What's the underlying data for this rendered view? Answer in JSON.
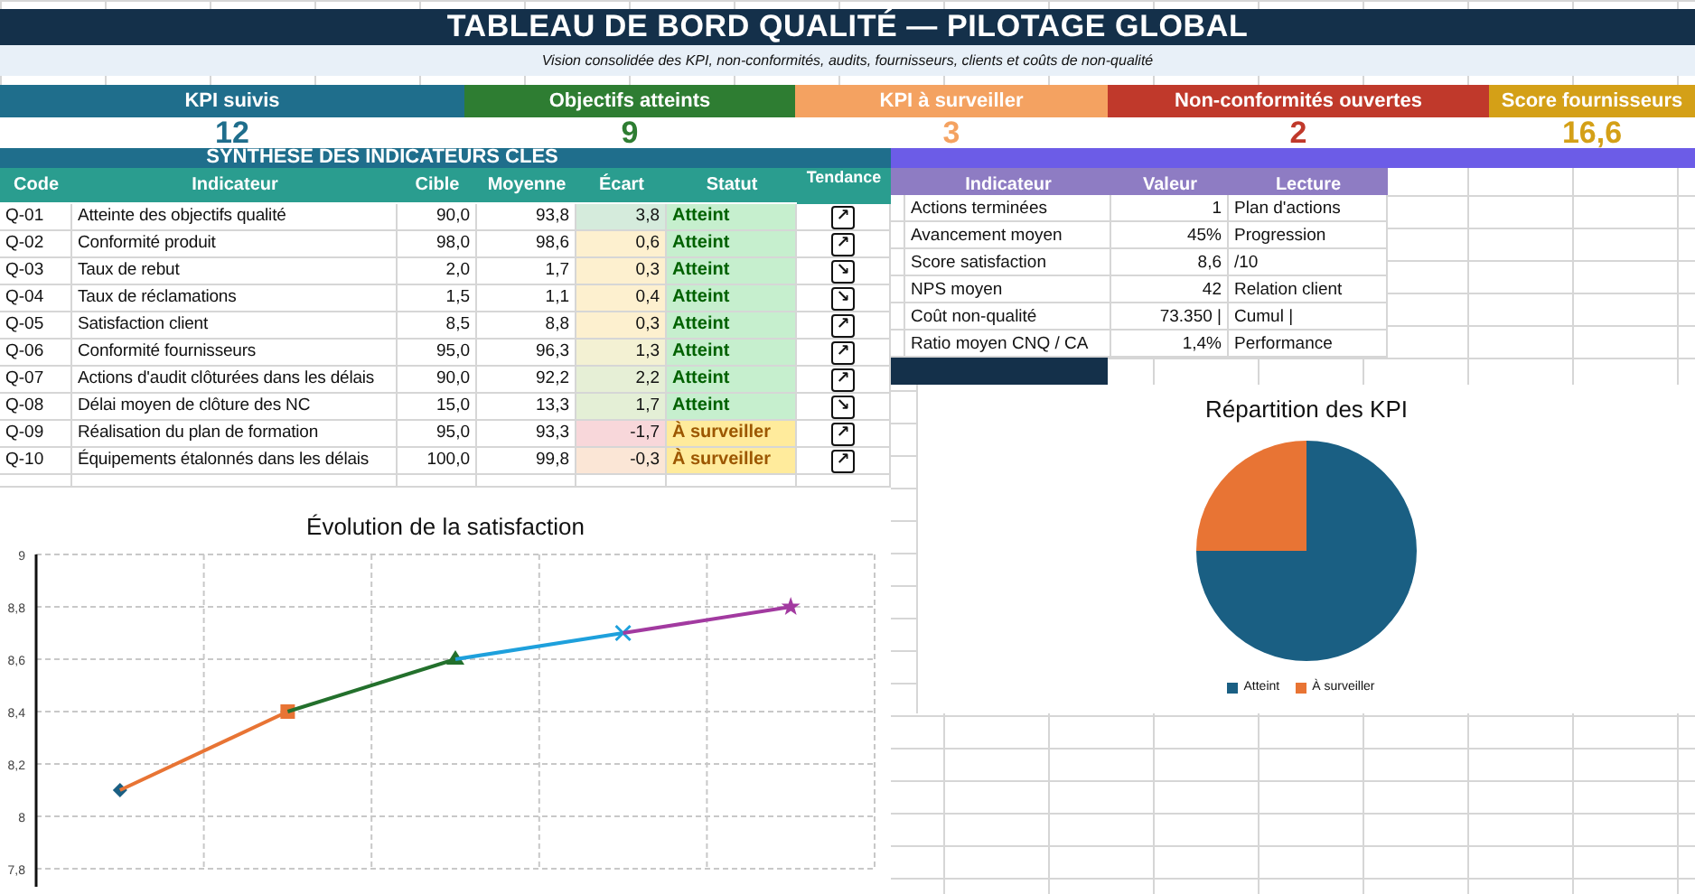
{
  "title": "TABLEAU DE BORD QUALITÉ — PILOTAGE GLOBAL",
  "subtitle": "Vision consolidée des KPI, non-conformités, audits, fournisseurs, clients et coûts de non-qualité",
  "kpis": [
    {
      "label": "KPI suivis",
      "value": "12",
      "color": "#1f6e8c"
    },
    {
      "label": "Objectifs atteints",
      "value": "9",
      "color": "#2e7d32"
    },
    {
      "label": "KPI à surveiller",
      "value": "3",
      "color": "#f4a261"
    },
    {
      "label": "Non-conformités ouvertes",
      "value": "2",
      "color": "#c0392b"
    },
    {
      "label": "Score fournisseurs",
      "value": "16,6",
      "color": "#d4a017"
    }
  ],
  "section_title": "SYNTHESE DES INDICATEURS CLES",
  "table": {
    "columns": [
      "Code",
      "Indicateur",
      "Cible",
      "Moyenne",
      "Écart",
      "Statut",
      "Tendance"
    ],
    "rows": [
      {
        "code": "Q-01",
        "indicator": "Atteinte des objectifs qualité",
        "target": "90,0",
        "average": "93,8",
        "gap": "3,8",
        "color": "#d5ebdc",
        "status": "Atteint",
        "kind": "ok",
        "trend": "↗"
      },
      {
        "code": "Q-02",
        "indicator": "Conformité produit",
        "target": "98,0",
        "average": "98,6",
        "gap": "0,6",
        "color": "#fdf0cf",
        "status": "Atteint",
        "kind": "ok",
        "trend": "↗"
      },
      {
        "code": "Q-03",
        "indicator": "Taux de rebut",
        "target": "2,0",
        "average": "1,7",
        "gap": "0,3",
        "color": "#fdf0cf",
        "status": "Atteint",
        "kind": "ok",
        "trend": "↘"
      },
      {
        "code": "Q-04",
        "indicator": "Taux de réclamations",
        "target": "1,5",
        "average": "1,1",
        "gap": "0,4",
        "color": "#fdf0cf",
        "status": "Atteint",
        "kind": "ok",
        "trend": "↘"
      },
      {
        "code": "Q-05",
        "indicator": "Satisfaction client",
        "target": "8,5",
        "average": "8,8",
        "gap": "0,3",
        "color": "#fdf0cf",
        "status": "Atteint",
        "kind": "ok",
        "trend": "↗"
      },
      {
        "code": "Q-06",
        "indicator": "Conformité fournisseurs",
        "target": "95,0",
        "average": "96,3",
        "gap": "1,3",
        "color": "#f3f1d3",
        "status": "Atteint",
        "kind": "ok",
        "trend": "↗"
      },
      {
        "code": "Q-07",
        "indicator": "Actions d'audit clôturées dans les délais",
        "target": "90,0",
        "average": "92,2",
        "gap": "2,2",
        "color": "#e6efd6",
        "status": "Atteint",
        "kind": "ok",
        "trend": "↗"
      },
      {
        "code": "Q-08",
        "indicator": "Délai moyen de clôture des NC",
        "target": "15,0",
        "average": "13,3",
        "gap": "1,7",
        "color": "#e4efd6",
        "status": "Atteint",
        "kind": "ok",
        "trend": "↘"
      },
      {
        "code": "Q-09",
        "indicator": "Réalisation du plan de formation",
        "target": "95,0",
        "average": "93,3",
        "gap": "-1,7",
        "color": "#f8d7da",
        "status": "À surveiller",
        "kind": "watch",
        "trend": "↗"
      },
      {
        "code": "Q-10",
        "indicator": "Équipements étalonnés dans les délais",
        "target": "100,0",
        "average": "99,8",
        "gap": "-0,3",
        "color": "#fbe6d6",
        "status": "À surveiller",
        "kind": "watch",
        "trend": "↗"
      }
    ]
  },
  "side_table": {
    "columns": [
      "Indicateur",
      "Valeur",
      "Lecture"
    ],
    "rows": [
      {
        "indicator": "Actions terminées",
        "value": "1",
        "reading": "Plan d'actions"
      },
      {
        "indicator": "Avancement moyen",
        "value": "45%",
        "reading": "Progression"
      },
      {
        "indicator": "Score satisfaction",
        "value": "8,6",
        "reading": "/10"
      },
      {
        "indicator": "NPS moyen",
        "value": "42",
        "reading": "Relation client"
      },
      {
        "indicator": "Coût non-qualité",
        "value": "73.350 |",
        "reading": "Cumul |"
      },
      {
        "indicator": "Ratio moyen CNQ / CA",
        "value": "1,4%",
        "reading": "Performance"
      }
    ]
  },
  "line_chart": {
    "chart_data": {
      "type": "line",
      "title": "Évolution de la satisfaction",
      "grid": true,
      "series": [
        {
          "color": "#1a5f83",
          "marker": "diamond",
          "values": [
            8.1,
            null,
            null,
            null,
            null
          ]
        },
        {
          "color": "#e87434",
          "marker": "square",
          "values": [
            8.1,
            8.4,
            null,
            null,
            null
          ]
        },
        {
          "color": "#23702c",
          "marker": "triangle",
          "values": [
            null,
            8.4,
            8.6,
            null,
            null
          ]
        },
        {
          "color": "#1ea0dc",
          "marker": "cross",
          "values": [
            null,
            null,
            8.6,
            8.7,
            null
          ]
        },
        {
          "color": "#a23aa0",
          "marker": "star",
          "values": [
            null,
            null,
            null,
            8.7,
            8.8
          ]
        }
      ],
      "ylim": [
        7.8,
        9
      ],
      "yticks": [
        {
          "value": 7.8,
          "label": "7,8"
        },
        {
          "value": 8,
          "label": "8"
        },
        {
          "value": 8.2,
          "label": "8,2"
        },
        {
          "value": 8.4,
          "label": "8,4"
        },
        {
          "value": 8.6,
          "label": "8,6"
        },
        {
          "value": 8.8,
          "label": "8,8"
        },
        {
          "value": 9,
          "label": "9"
        }
      ]
    }
  },
  "pie_chart": {
    "chart_data": {
      "type": "pie",
      "title": "Répartition des KPI",
      "legend": "bottom",
      "categories": [
        "Atteint",
        "À surveiller"
      ],
      "values": [
        75,
        25
      ],
      "colors": [
        "#1a5f83",
        "#e87434"
      ]
    }
  }
}
